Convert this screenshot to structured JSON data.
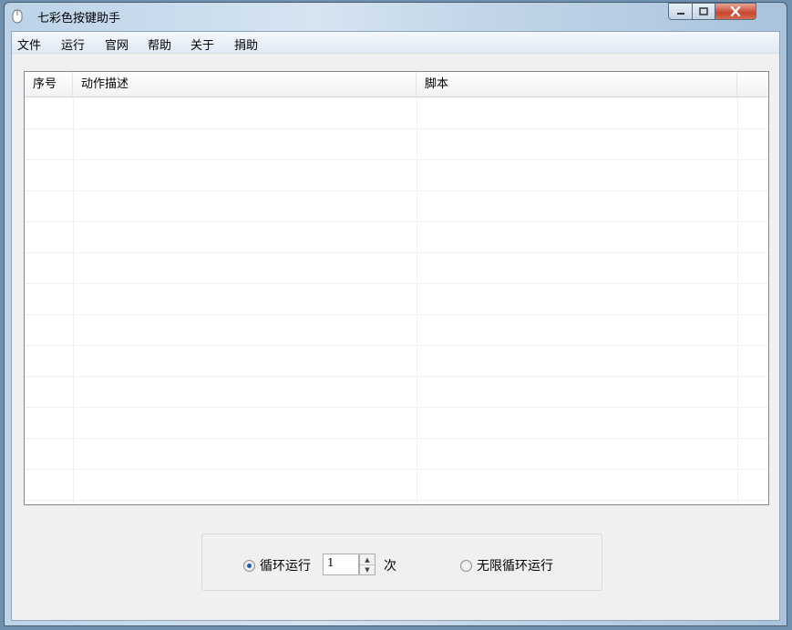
{
  "window": {
    "title": "七彩色按键助手",
    "controls": {
      "minimize": "minimize-icon",
      "maximize": "maximize-icon",
      "close": "close-icon"
    }
  },
  "menu": [
    "文件",
    "运行",
    "官网",
    "帮助",
    "关于",
    "捐助"
  ],
  "table": {
    "columns": [
      "序号",
      "动作描述",
      "脚本"
    ],
    "rows": []
  },
  "loop": {
    "loop_label": "循环运行",
    "count_value": "1",
    "count_unit": "次",
    "infinite_label": "无限循环运行",
    "selected": "loop"
  },
  "colors": {
    "accent": "#1f5fa9",
    "close_button": "#c7462f"
  }
}
